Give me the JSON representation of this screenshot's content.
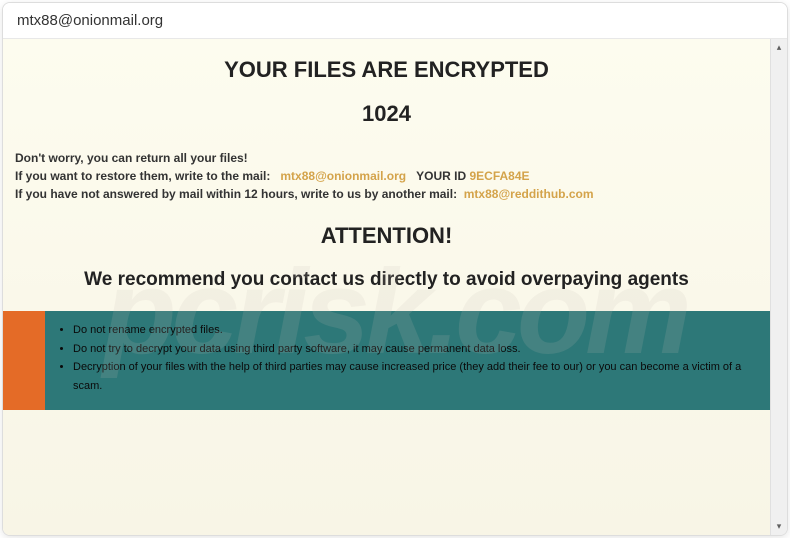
{
  "titleBar": {
    "title": "mtx88@onionmail.org"
  },
  "content": {
    "heading": "YOUR FILES ARE ENCRYPTED",
    "number": "1024",
    "dontWorry": "Don't worry, you can return all your files!",
    "restoreLine": {
      "prefix": "If you want to restore them, write to the mail: ",
      "email": "mtx88@onionmail.org",
      "yourIdLabel": "YOUR ID",
      "yourIdValue": "9ECFA84E"
    },
    "notAnsweredLine": {
      "prefix": "If you have not answered by mail within 12 hours, write to us by another mail: ",
      "email": "mtx88@reddithub.com"
    },
    "attention": "ATTENTION!",
    "recommend": "We recommend you contact us directly to avoid overpaying agents",
    "warnings": [
      "Do not rename encrypted files.",
      "Do not try to decrypt your data using third party software, it may cause permanent data loss.",
      "Decryption of your files with the help of third parties may cause increased price (they add their fee to our) or you can become a victim of a scam."
    ]
  },
  "scrollbar": {
    "upArrow": "▴",
    "downArrow": "▾"
  },
  "watermark": "pcrisk.com"
}
